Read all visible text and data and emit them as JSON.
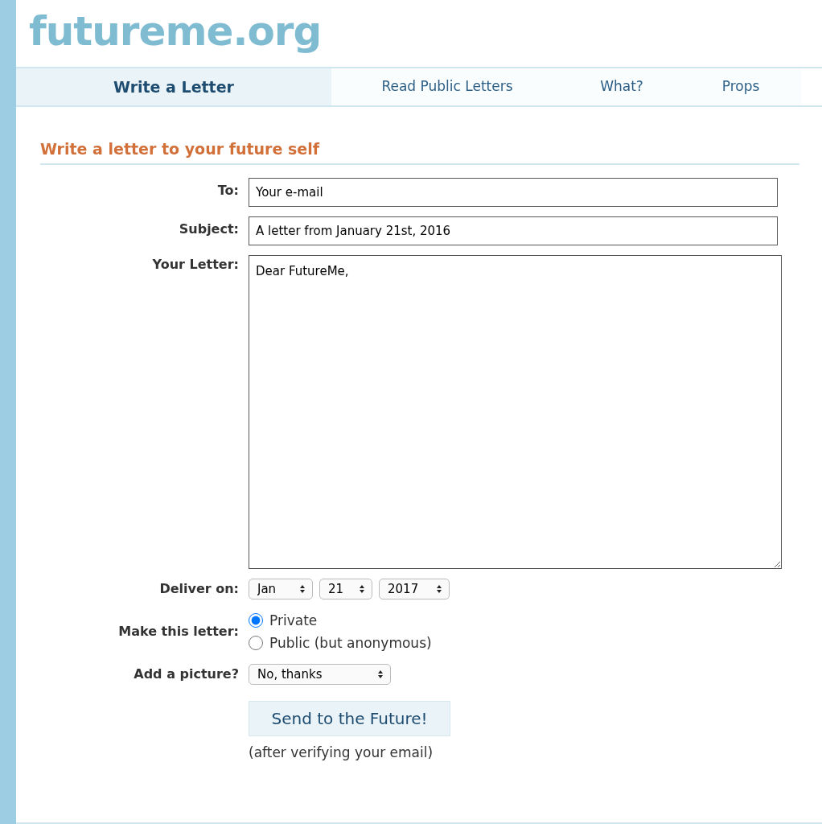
{
  "logo": "futureme.org",
  "tabs": [
    {
      "label": "Write a Letter",
      "selected": true
    },
    {
      "label": "Read Public Letters",
      "selected": false
    },
    {
      "label": "What?",
      "selected": false
    },
    {
      "label": "Props",
      "selected": false
    }
  ],
  "heading": "Write a letter to your future self",
  "form": {
    "to": {
      "label": "To:",
      "value": "Your e-mail"
    },
    "subject": {
      "label": "Subject:",
      "value": "A letter from January 21st, 2016"
    },
    "letter": {
      "label": "Your Letter:",
      "value": "Dear FutureMe,"
    },
    "deliver": {
      "label": "Deliver on:",
      "selects": [
        "Jan",
        "21",
        "2017"
      ]
    },
    "visibility": {
      "label": "Make this letter:",
      "options": [
        {
          "label": "Private",
          "selected": true
        },
        {
          "label": "Public (but anonymous)",
          "selected": false
        }
      ]
    },
    "picture": {
      "label": "Add a picture?",
      "value": "No, thanks"
    },
    "submit": "Send to the Future!",
    "note": "(after verifying your email)"
  }
}
